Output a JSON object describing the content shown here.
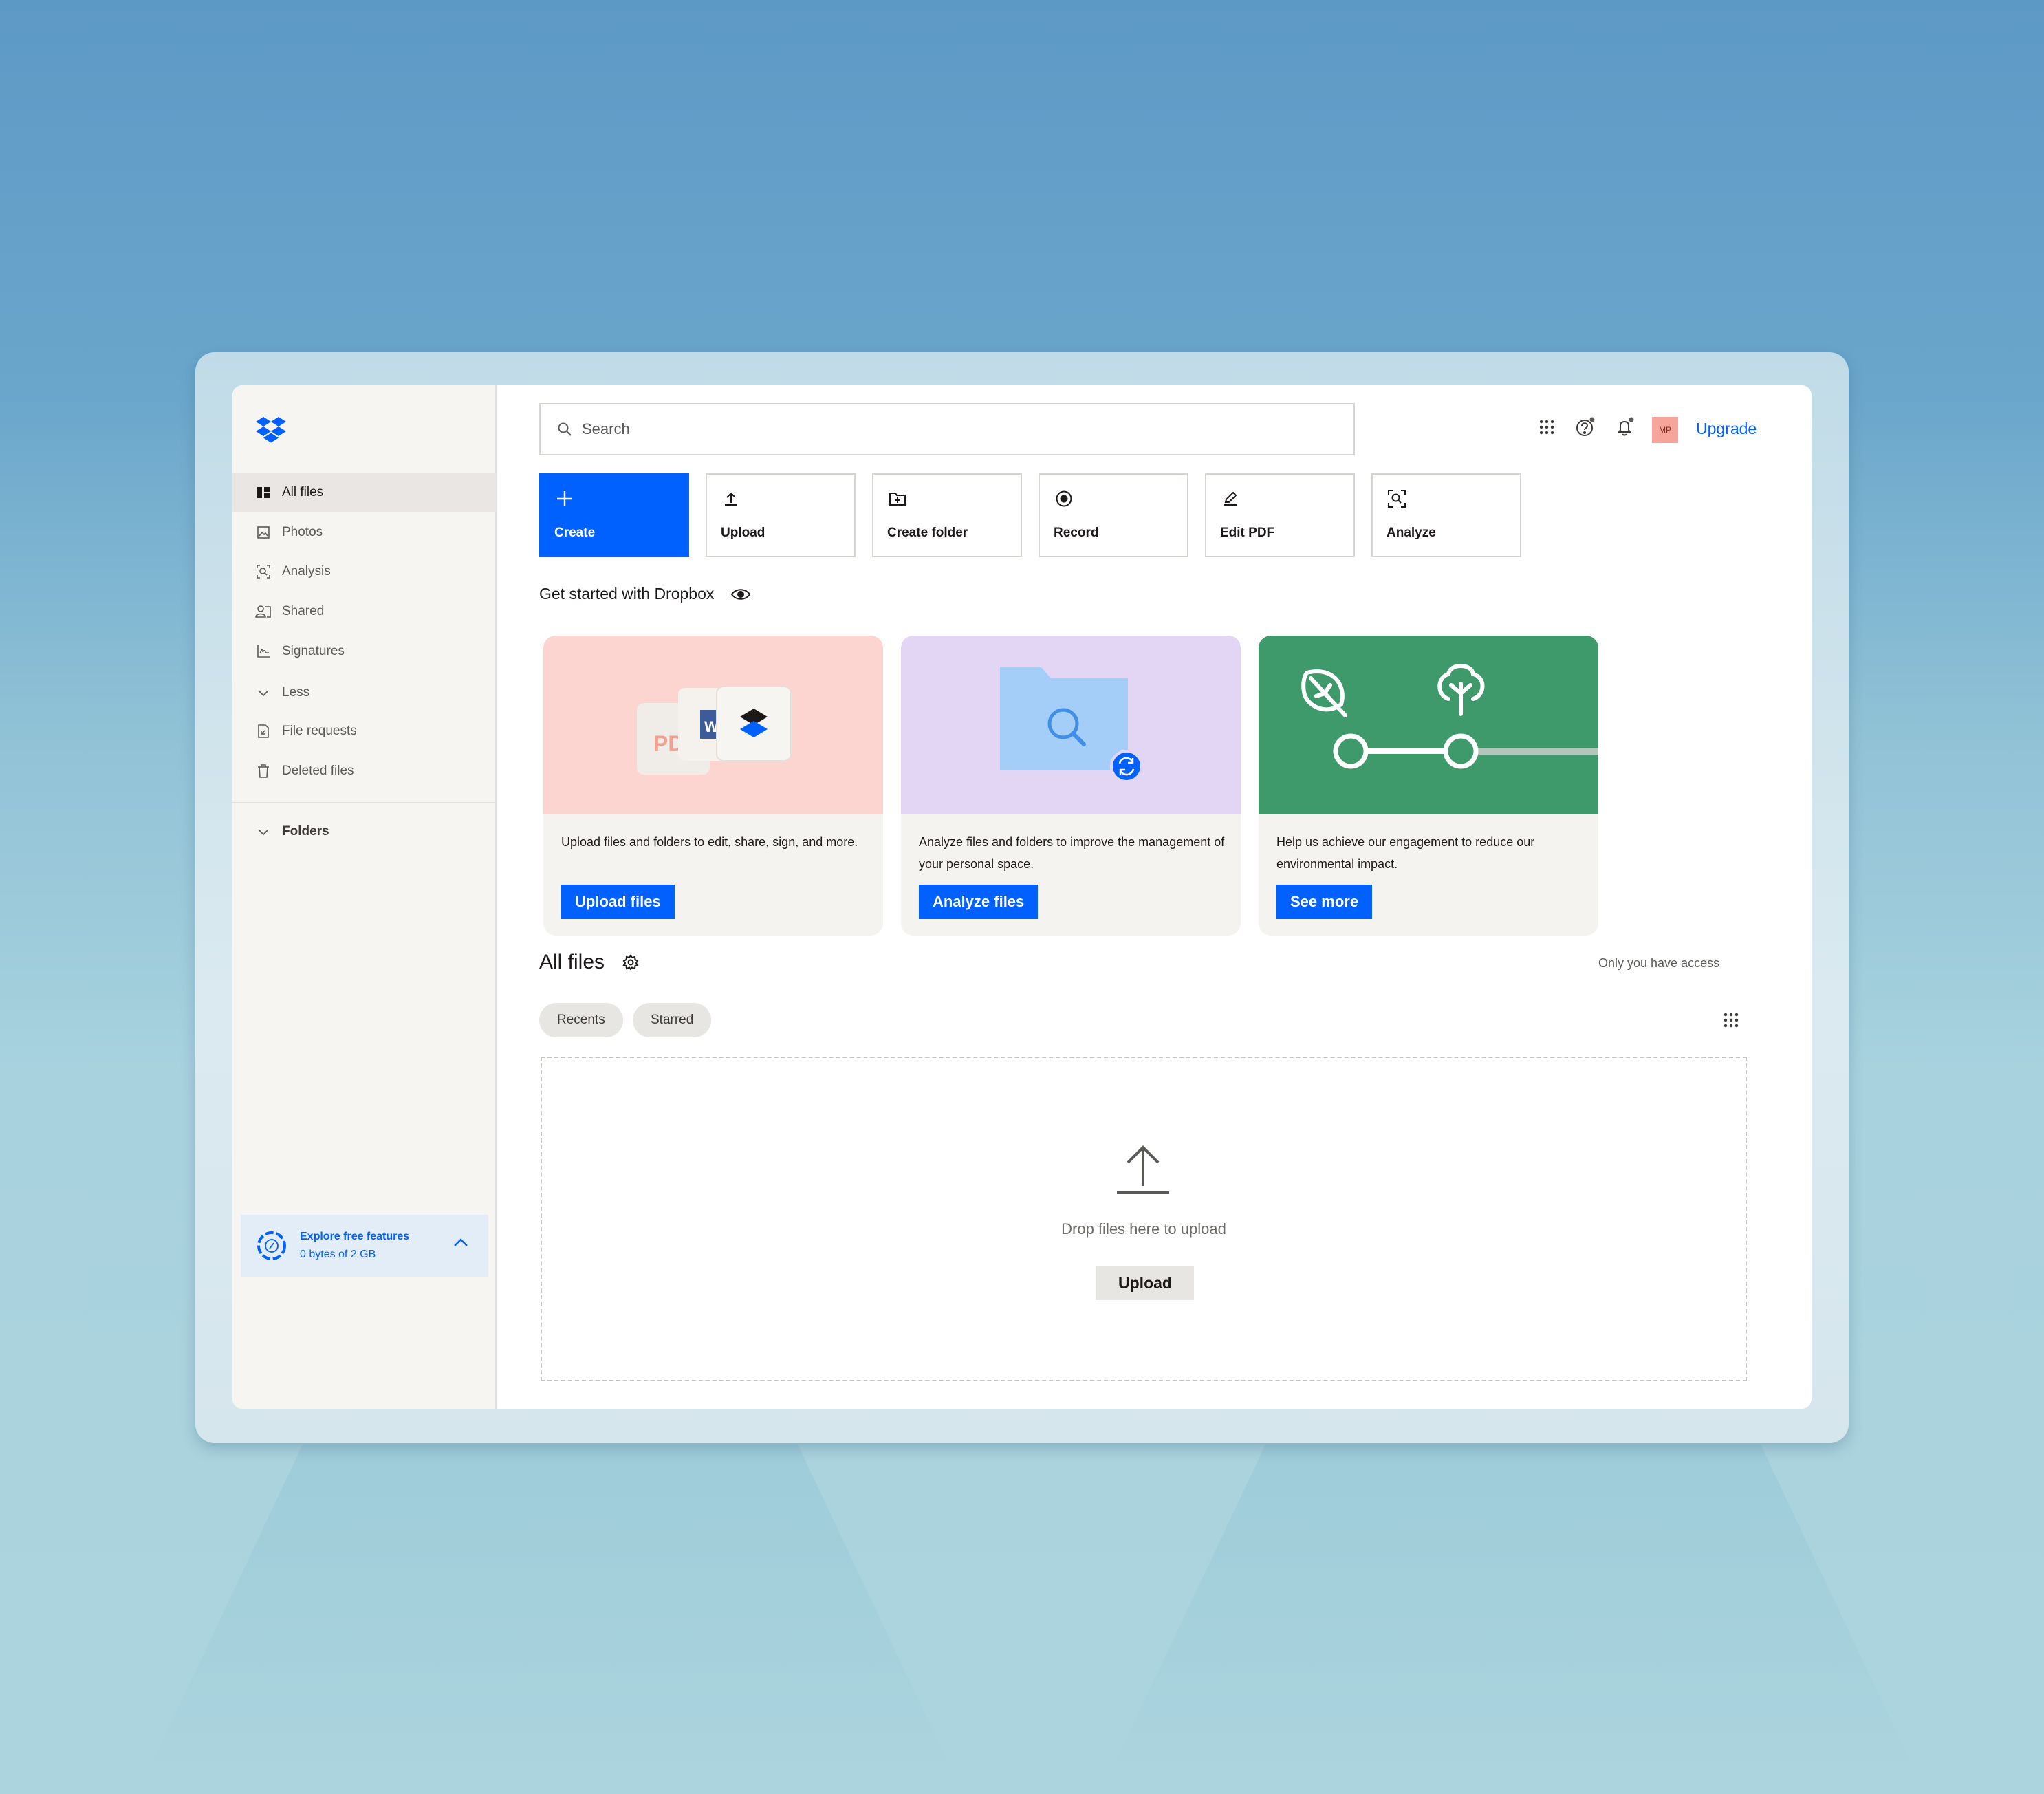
{
  "sidebar": {
    "items": [
      {
        "label": "All files",
        "icon": "all-files-icon"
      },
      {
        "label": "Photos",
        "icon": "photos-icon"
      },
      {
        "label": "Analysis",
        "icon": "analysis-icon"
      },
      {
        "label": "Shared",
        "icon": "shared-icon"
      },
      {
        "label": "Signatures",
        "icon": "signatures-icon"
      },
      {
        "label": "Less",
        "icon": "chevron-down-icon"
      },
      {
        "label": "File requests",
        "icon": "file-requests-icon"
      },
      {
        "label": "Deleted files",
        "icon": "trash-icon"
      }
    ],
    "folders_label": "Folders",
    "explore": {
      "title": "Explore free features",
      "storage": "0 bytes of 2 GB"
    }
  },
  "header": {
    "search_placeholder": "Search",
    "avatar_initials": "MP",
    "upgrade_label": "Upgrade"
  },
  "actions": [
    {
      "label": "Create",
      "icon": "plus-icon"
    },
    {
      "label": "Upload",
      "icon": "upload-icon"
    },
    {
      "label": "Create folder",
      "icon": "create-folder-icon"
    },
    {
      "label": "Record",
      "icon": "record-icon"
    },
    {
      "label": "Edit PDF",
      "icon": "pencil-icon"
    },
    {
      "label": "Analyze",
      "icon": "analyze-icon"
    }
  ],
  "get_started": {
    "title": "Get started with Dropbox",
    "cards": [
      {
        "description": "Upload files and folders to edit, share, sign, and more.",
        "button": "Upload files",
        "bg": "#fdd5d0"
      },
      {
        "description": "Analyze files and folders to improve the management of your personal space.",
        "button": "Analyze files",
        "bg": "#e3d6f5"
      },
      {
        "description": "Help us achieve our engagement to reduce our environmental impact.",
        "button": "See more",
        "bg": "#3e996b"
      }
    ]
  },
  "all_files": {
    "title": "All files",
    "access_note": "Only you have access",
    "tabs": [
      "Recents",
      "Starred"
    ],
    "dropzone": {
      "text": "Drop files here to upload",
      "button": "Upload"
    }
  },
  "colors": {
    "accent": "#0061fe",
    "sidebar_bg": "#f7f5f2"
  }
}
